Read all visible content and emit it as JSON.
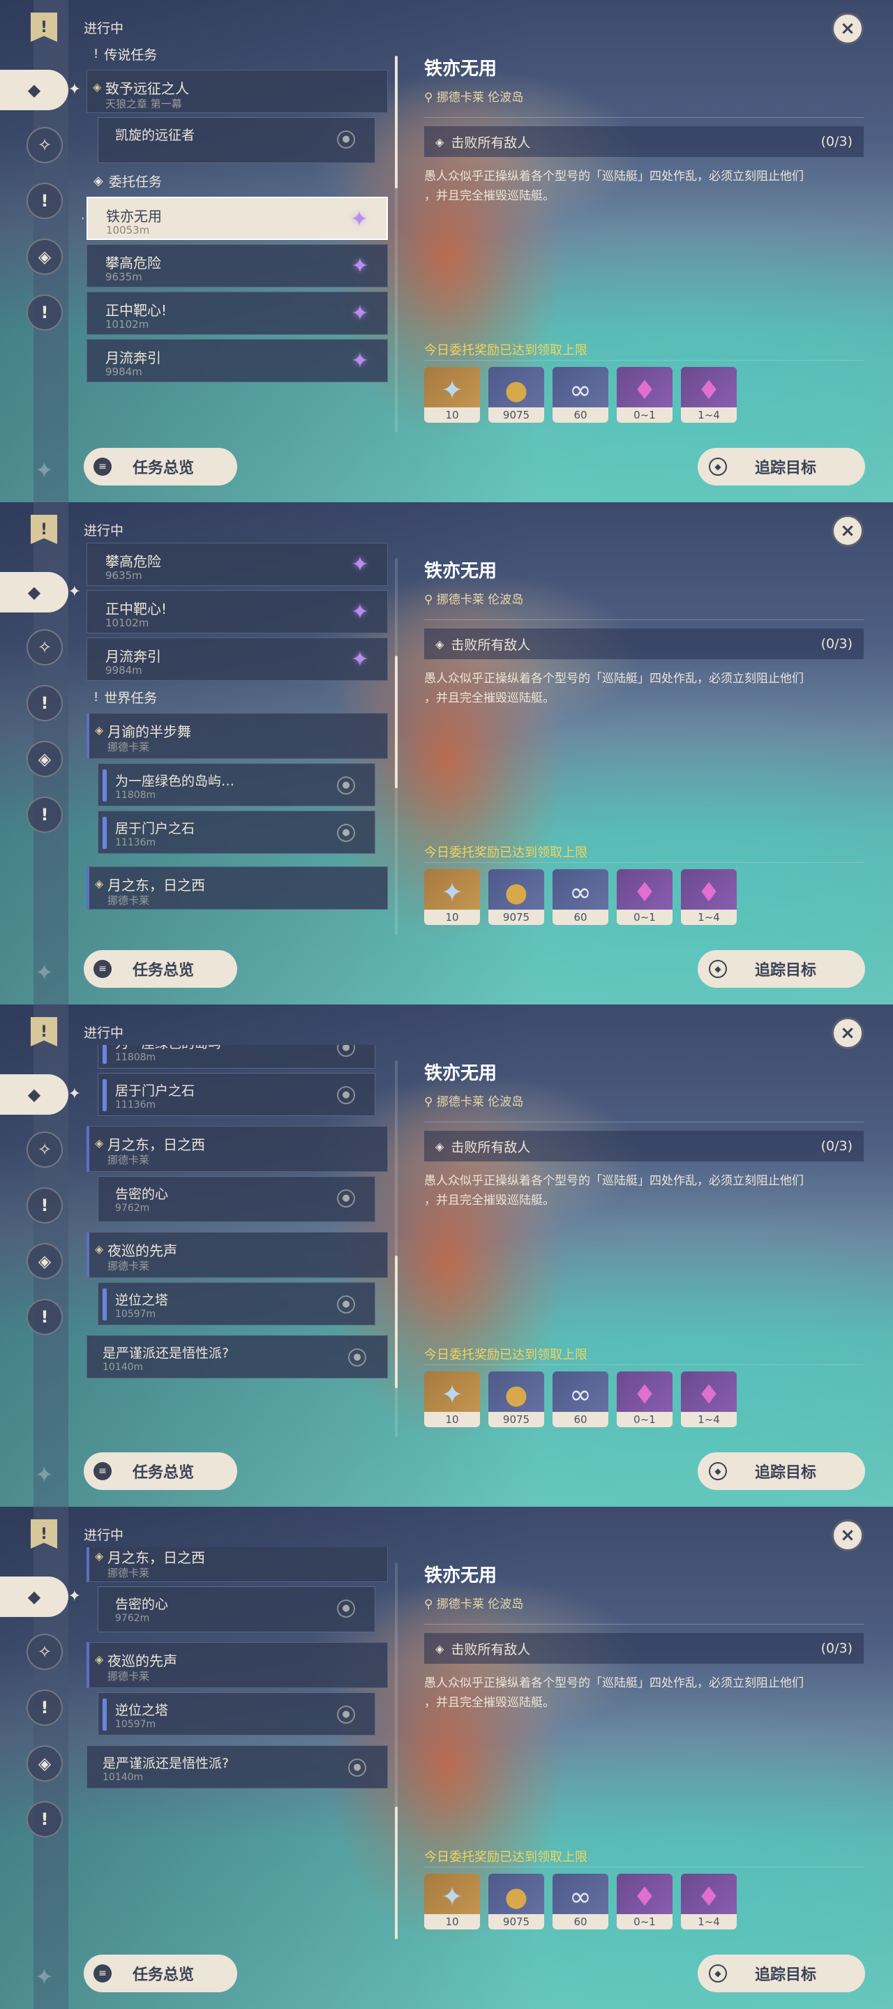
{
  "header": {
    "progress_label": "进行中",
    "close_icon": "×"
  },
  "rail": {
    "icons": [
      "!",
      "◆",
      "✧",
      "!",
      "◈",
      "!"
    ]
  },
  "categories": {
    "legend": "传说任务",
    "commission": "委托任务",
    "world": "世界任务"
  },
  "quests": {
    "legend_main": {
      "title": "致予远征之人",
      "subtitle": "天狼之章 第一幕"
    },
    "legend_sub": {
      "title": "凯旋的远征者"
    },
    "commissions": [
      {
        "title": "铁亦无用",
        "distance": "10053m"
      },
      {
        "title": "攀高危险",
        "distance": "9635m"
      },
      {
        "title": "正中靶心!",
        "distance": "10102m"
      },
      {
        "title": "月流奔引",
        "distance": "9984m"
      }
    ],
    "world": [
      {
        "title": "月谕的半步舞",
        "subtitle": "挪德卡莱",
        "subs": [
          {
            "title": "为一座绿色的岛屿…",
            "distance": "11808m"
          },
          {
            "title": "居于门户之石",
            "distance": "11136m"
          }
        ]
      },
      {
        "title": "月之东，日之西",
        "subtitle": "挪德卡莱",
        "subs": [
          {
            "title": "告密的心",
            "distance": "9762m"
          }
        ]
      },
      {
        "title": "夜巡的先声",
        "subtitle": "挪德卡莱",
        "subs": [
          {
            "title": "逆位之塔",
            "distance": "10597m"
          }
        ]
      }
    ],
    "standalone": {
      "title": "是严谨派还是悟性派?",
      "distance": "10140m"
    },
    "partial_sub": {
      "title": "为一座绿色的岛屿",
      "distance": "11808m"
    }
  },
  "detail": {
    "title": "铁亦无用",
    "location": "挪德卡莱 伦波岛",
    "objective": "击败所有敌人",
    "objective_count": "(0/3)",
    "description_line1": "愚人众似乎正操纵着各个型号的「巡陆艇」四处作乱，必须立刻阻止他们",
    "description_line2": "，并且完全摧毁巡陆艇。",
    "reward_limit": "今日委托奖励已达到领取上限",
    "rewards": [
      {
        "icon": "primogem-icon",
        "count": "10"
      },
      {
        "icon": "mora-icon",
        "count": "9075"
      },
      {
        "icon": "companionship-icon",
        "count": "60"
      },
      {
        "icon": "crystal-icon",
        "count": "0~1"
      },
      {
        "icon": "crystal-cluster-icon",
        "count": "1~4"
      }
    ]
  },
  "buttons": {
    "overview": "任务总览",
    "track": "追踪目标"
  },
  "colors": {
    "accent": "#ece5d8",
    "gold": "#f3d45c",
    "commission_star": "#b98df0"
  }
}
